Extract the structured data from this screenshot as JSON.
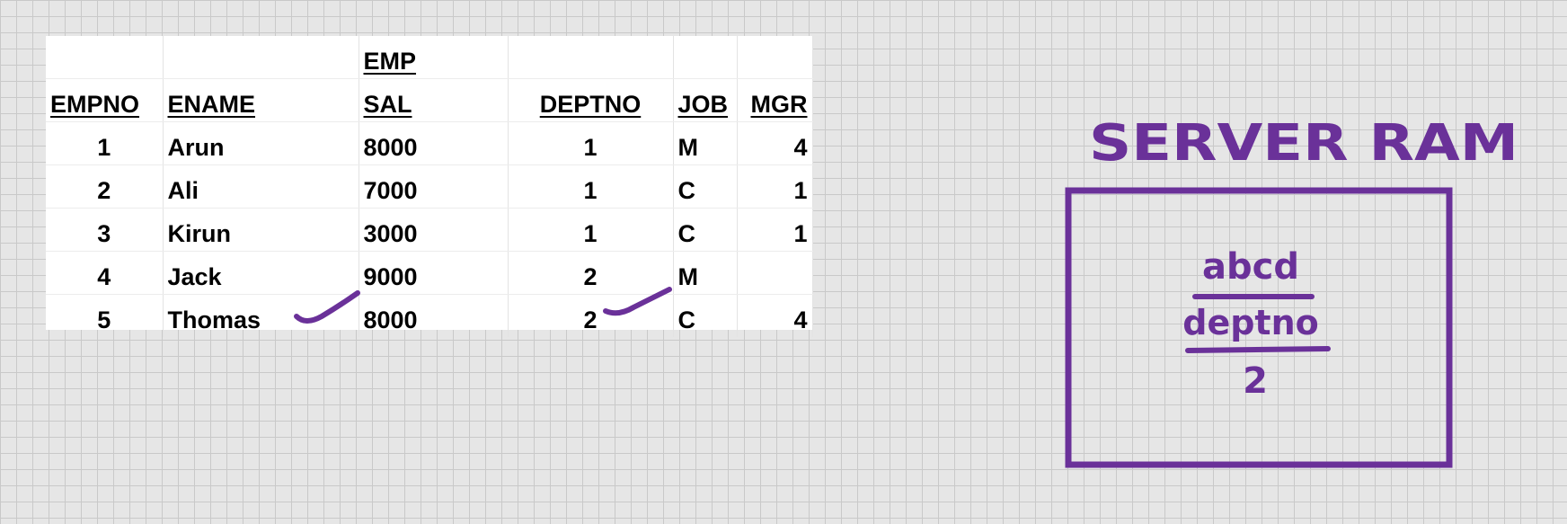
{
  "table": {
    "title": "EMP",
    "columns": [
      "EMPNO",
      "ENAME",
      "SAL",
      "DEPTNO",
      "JOB",
      "MGR"
    ],
    "rows": [
      [
        "1",
        "Arun",
        "8000",
        "1",
        "M",
        "4"
      ],
      [
        "2",
        "Ali",
        "7000",
        "1",
        "C",
        "1"
      ],
      [
        "3",
        "Kirun",
        "3000",
        "1",
        "C",
        "1"
      ],
      [
        "4",
        "Jack",
        "9000",
        "2",
        "M",
        ""
      ],
      [
        "5",
        "Thomas",
        "8000",
        "2",
        "C",
        "4"
      ]
    ]
  },
  "annotation": {
    "box_label": "SERVER RAM",
    "lines": [
      "abcd",
      "deptno",
      "2"
    ],
    "ink_color": "#6a3199"
  }
}
